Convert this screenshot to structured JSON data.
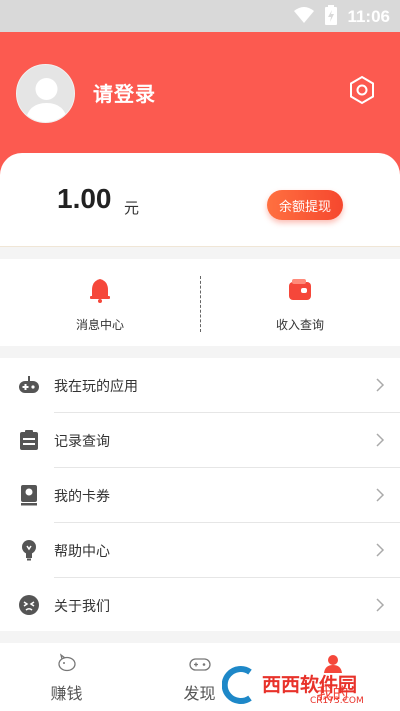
{
  "status_bar": {
    "time": "11:06",
    "icons": [
      "wifi-icon",
      "battery-charging-icon"
    ]
  },
  "header": {
    "login_text": "请登录",
    "avatar_icon": "avatar-placeholder-icon",
    "settings_icon": "settings-hexagon-icon"
  },
  "balance": {
    "amount": "1.00",
    "unit": "元",
    "withdraw_label": "余额提现"
  },
  "quick_links": [
    {
      "label": "消息中心",
      "icon": "bell-icon"
    },
    {
      "label": "收入查询",
      "icon": "wallet-icon"
    }
  ],
  "menu": [
    {
      "label": "我在玩的应用",
      "icon": "gamepad-icon"
    },
    {
      "label": "记录查询",
      "icon": "clipboard-icon"
    },
    {
      "label": "我的卡券",
      "icon": "card-icon"
    },
    {
      "label": "帮助中心",
      "icon": "lightbulb-icon"
    },
    {
      "label": "关于我们",
      "icon": "smiley-icon"
    }
  ],
  "tabs": [
    {
      "label": "赚钱",
      "icon": "piggy-icon"
    },
    {
      "label": "发现",
      "icon": "gamepad-icon"
    },
    {
      "label": "我的",
      "icon": "user-icon"
    }
  ],
  "watermark": {
    "text": "西西软件园",
    "url_text": "CR173.COM"
  },
  "colors": {
    "brand_red": "#fc5a50",
    "button_start": "#ff7040",
    "button_end": "#f6472e"
  }
}
